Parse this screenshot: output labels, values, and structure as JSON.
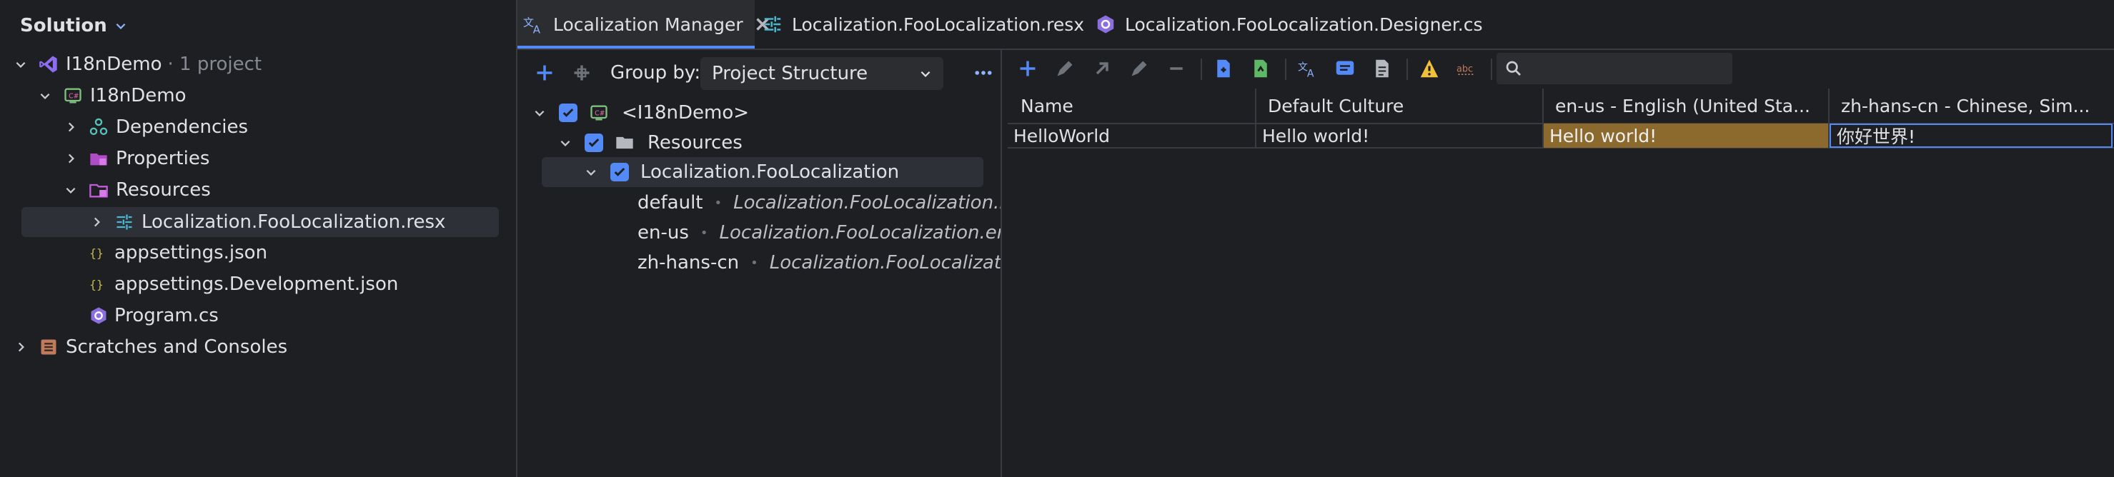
{
  "solution_panel": {
    "title": "Solution",
    "items": [
      {
        "label": "I18nDemo",
        "suffix": "· 1 project"
      },
      {
        "label": "I18nDemo"
      },
      {
        "label": "Dependencies"
      },
      {
        "label": "Properties"
      },
      {
        "label": "Resources"
      },
      {
        "label": "Localization.FooLocalization.resx"
      },
      {
        "label": "appsettings.json"
      },
      {
        "label": "appsettings.Development.json"
      },
      {
        "label": "Program.cs"
      },
      {
        "label": "Scratches and Consoles"
      }
    ]
  },
  "tabs": [
    {
      "label": "Localization Manager",
      "active": true
    },
    {
      "label": "Localization.FooLocalization.resx"
    },
    {
      "label": "Localization.FooLocalization.Designer.cs"
    }
  ],
  "resource_tree": {
    "group_by_label": "Group by:",
    "group_by_value": "Project Structure",
    "nodes": [
      {
        "label": "<I18nDemo>"
      },
      {
        "label": "Resources"
      },
      {
        "label": "Localization.FooLocalization"
      }
    ],
    "cultures": [
      {
        "name": "default",
        "file": "Localization.FooLocalization.resx"
      },
      {
        "name": "en-us",
        "file": "Localization.FooLocalization.en-us.resx"
      },
      {
        "name": "zh-hans-cn",
        "file": "Localization.FooLocalization.zh-hans-cn.resx"
      }
    ]
  },
  "grid": {
    "search_placeholder": "",
    "columns": [
      "Name",
      "Default Culture",
      "en-us - English (United Sta...",
      "zh-hans-cn - Chinese, Sim..."
    ],
    "rows": [
      [
        "HelloWorld",
        "Hello world!",
        "Hello world!",
        "你好世界!"
      ]
    ]
  },
  "colors": {
    "background": "#1e1f22",
    "accent": "#548af7",
    "highlight_cell": "#8c6a2e",
    "selected_row": "#2e3038"
  }
}
